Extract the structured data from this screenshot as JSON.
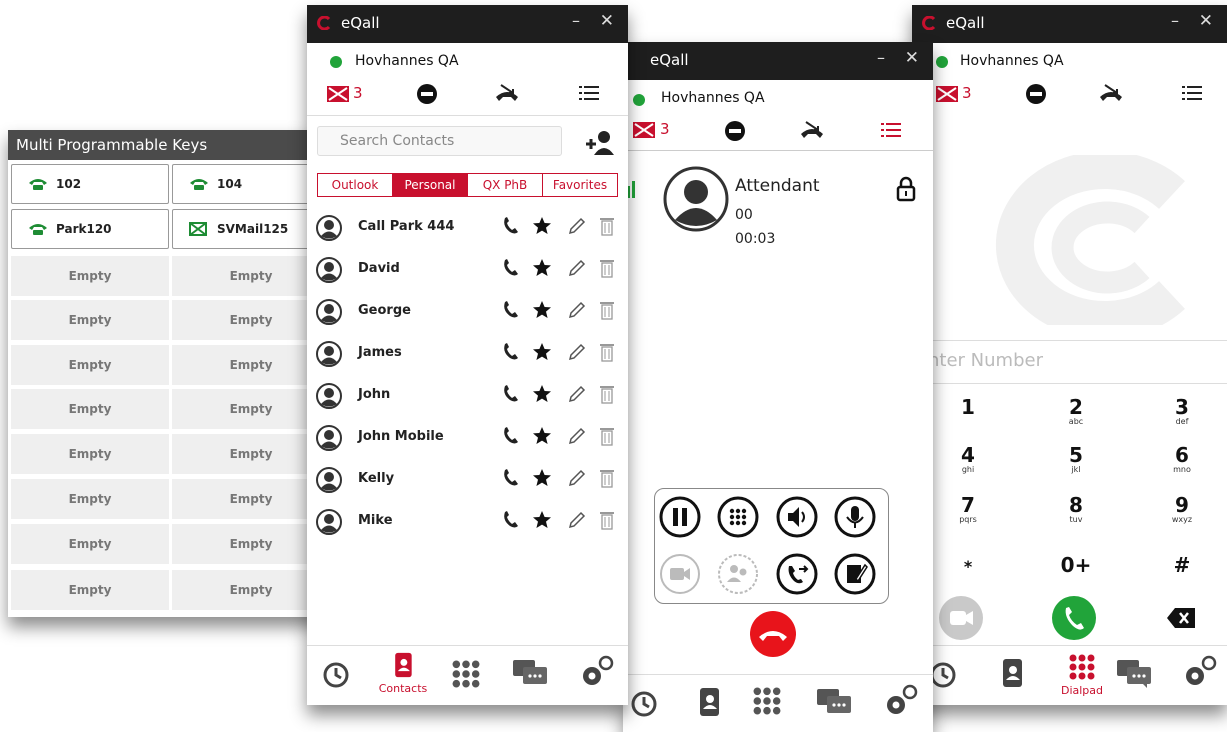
{
  "mpk": {
    "title": "Multi Programmable Keys",
    "keys": [
      {
        "label": "102",
        "type": "phone"
      },
      {
        "label": "104",
        "type": "phone"
      },
      {
        "label": "Park120",
        "type": "phone"
      },
      {
        "label": "SVMail125",
        "type": "mail"
      }
    ],
    "empty_label": "Empty"
  },
  "contacts_window": {
    "title": "eQall",
    "user": "Hovhannes QA",
    "voicemail_count": "3",
    "search_placeholder": "Search Contacts",
    "tabs": [
      "Outlook",
      "Personal",
      "QX PhB",
      "Favorites"
    ],
    "active_tab": "Personal",
    "contacts": [
      "Call Park 444",
      "David",
      "George",
      "James",
      "John",
      "John Mobile",
      "Kelly",
      "Mike"
    ],
    "bottom_nav_active_label": "Contacts"
  },
  "call_window": {
    "title": "eQall",
    "user": "Hovhannes QA",
    "voicemail_count": "3",
    "caller_name": "Attendant",
    "caller_number": "00",
    "call_duration": "00:03"
  },
  "dialpad_window": {
    "title": "eQall",
    "user": "Hovhannes QA",
    "voicemail_count": "3",
    "number_placeholder": "nter Number",
    "keys": [
      {
        "digit": "1",
        "letters": ""
      },
      {
        "digit": "2",
        "letters": "abc"
      },
      {
        "digit": "3",
        "letters": "def"
      },
      {
        "digit": "4",
        "letters": "ghi"
      },
      {
        "digit": "5",
        "letters": "jkl"
      },
      {
        "digit": "6",
        "letters": "mno"
      },
      {
        "digit": "7",
        "letters": "pqrs"
      },
      {
        "digit": "8",
        "letters": "tuv"
      },
      {
        "digit": "9",
        "letters": "wxyz"
      },
      {
        "digit": "*",
        "letters": ""
      },
      {
        "digit": "0+",
        "letters": ""
      },
      {
        "digit": "#",
        "letters": ""
      }
    ],
    "bottom_nav_active_label": "Dialpad"
  },
  "colors": {
    "brand_red": "#c8102e",
    "online_green": "#21a43a",
    "titlebar": "#1e1e1e"
  }
}
